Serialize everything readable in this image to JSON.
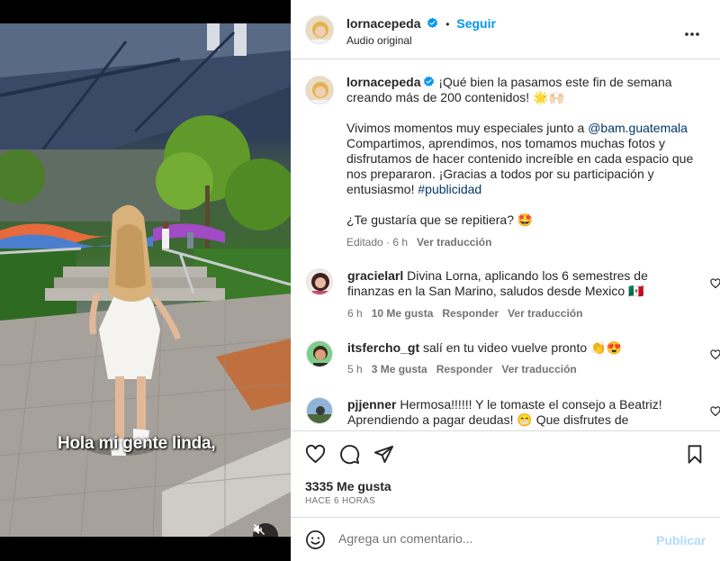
{
  "video": {
    "caption": "Hola mi gente linda,",
    "mute_icon": "speaker-muted-icon"
  },
  "header": {
    "username": "lornacepeda",
    "separator": "•",
    "follow_label": "Seguir",
    "audio_label": "Audio original",
    "more_icon": "more-horizontal-icon"
  },
  "post": {
    "username": "lornacepeda",
    "line1": "¡Qué bien la pasamos este fin de semana creando más de 200 contenidos! 🌟🙌🏻",
    "line2_prefix": "Vivimos momentos muy especiales junto a ",
    "mention": "@bam.guatemala",
    "line2_suffix": " Compartimos, aprendimos, nos tomamos muchas fotos y disfrutamos de hacer contenido increíble en cada espacio que nos prepararon. ¡Gracias a todos por su participación y entusiasmo! ",
    "hashtag": "#publicidad",
    "line3": "¿Te gustaría que se repitiera? 🤩",
    "edited": "Editado · 6 h",
    "translate": "Ver traducción"
  },
  "comments": [
    {
      "username": "gracielarl",
      "text": "Divina Lorna, aplicando los 6 semestres de finanzas en la San Marino, saludos desde Mexico 🇲🇽",
      "time": "6 h",
      "likes": "10 Me gusta",
      "reply": "Responder",
      "translate": "Ver traducción"
    },
    {
      "username": "itsfercho_gt",
      "text": "salí en tu video vuelve pronto 👏😍",
      "time": "5 h",
      "likes": "3 Me gusta",
      "reply": "Responder",
      "translate": "Ver traducción"
    },
    {
      "username": "pjjenner",
      "text": "Hermosa!!!!!! Y le tomaste el consejo a Beatriz! Aprendiendo a pagar deudas! 😁 Que disfrutes de"
    }
  ],
  "actions": {
    "likes": "3335 Me gusta",
    "time_ago": "HACE 6 HORAS"
  },
  "comment_box": {
    "placeholder": "Agrega un comentario...",
    "publish_label": "Publicar"
  },
  "colors": {
    "link_blue": "#0095f6",
    "mention": "#00376b",
    "publish_disabled": "#b3dbff",
    "muted_text": "#737373",
    "verified": "#0095f6"
  }
}
